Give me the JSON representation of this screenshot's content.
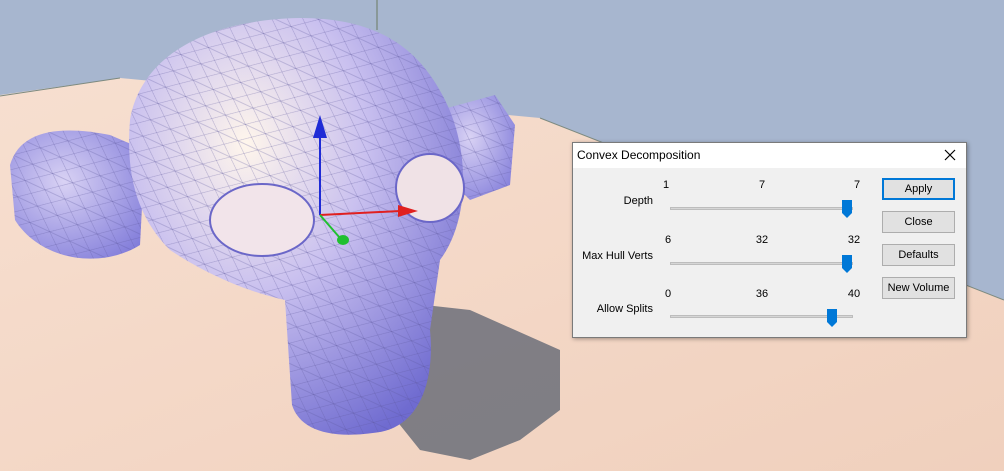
{
  "dialog": {
    "title": "Convex Decomposition",
    "close_icon": "close-icon"
  },
  "sliders": [
    {
      "label": "Depth",
      "min": "1",
      "value": "7",
      "max": "7",
      "fraction": 1.0
    },
    {
      "label": "Max Hull Verts",
      "min": "6",
      "value": "32",
      "max": "32",
      "fraction": 1.0
    },
    {
      "label": "Allow Splits",
      "min": "0",
      "value": "36",
      "max": "40",
      "fraction": 0.9
    }
  ],
  "buttons": {
    "apply": "Apply",
    "close": "Close",
    "defaults": "Defaults",
    "new_volume": "New Volume"
  },
  "colors": {
    "accent": "#0078d7",
    "mesh": "#8a86dc",
    "floor": "#f4d8c6",
    "sky": "#a7b6cf"
  }
}
